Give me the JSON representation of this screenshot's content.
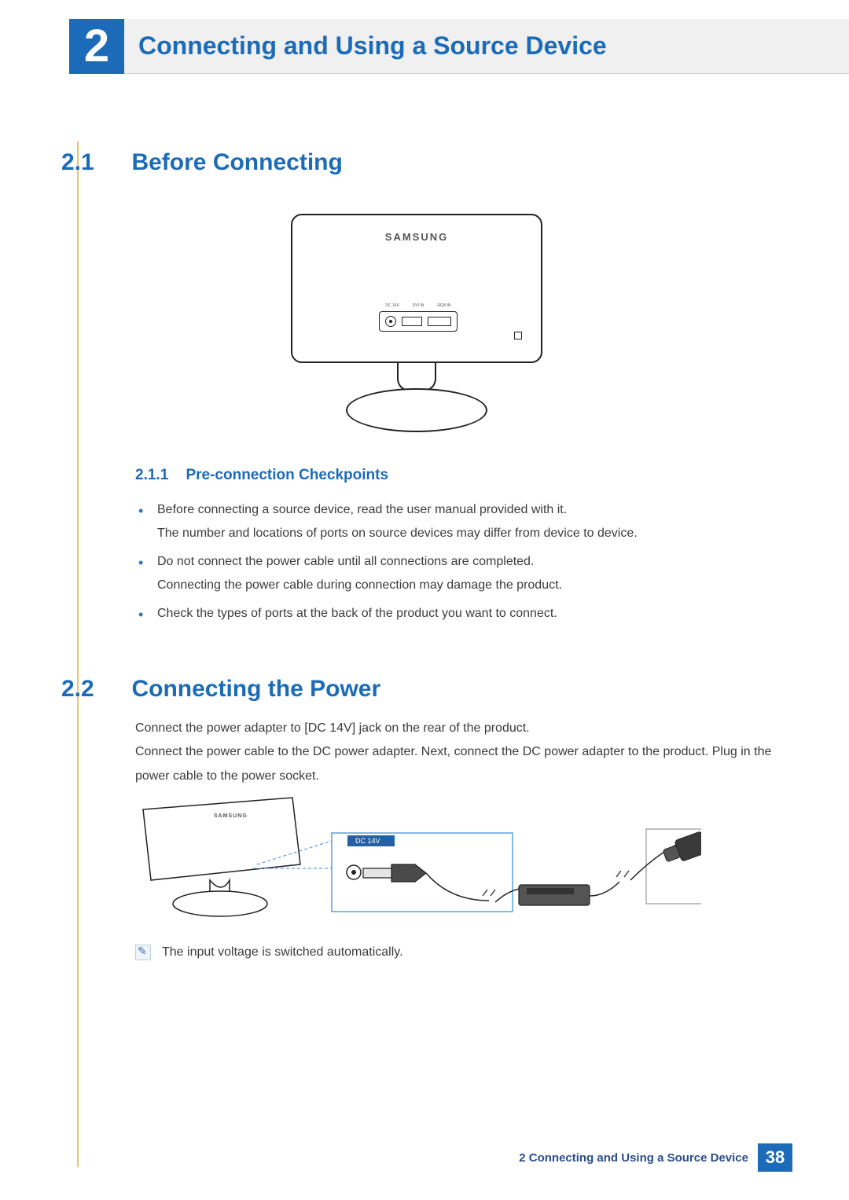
{
  "header": {
    "chapter_number": "2",
    "chapter_title": "Connecting and Using a Source Device"
  },
  "section_2_1": {
    "number": "2.1",
    "title": "Before Connecting"
  },
  "figure_monitor": {
    "brand": "SAMSUNG",
    "port_labels": {
      "a": "DC 14V",
      "b": "DVI IN",
      "c": "RGB IN"
    }
  },
  "subsection_2_1_1": {
    "number": "2.1.1",
    "title": "Pre-connection Checkpoints",
    "bullets": [
      {
        "line1": "Before connecting a source device, read the user manual provided with it.",
        "line2": "The number and locations of ports on source devices may differ from device to device."
      },
      {
        "line1": "Do not connect the power cable until all connections are completed.",
        "line2": "Connecting the power cable during connection may damage the product."
      },
      {
        "line1": "Check the types of ports at the back of the product you want to connect."
      }
    ]
  },
  "section_2_2": {
    "number": "2.2",
    "title": "Connecting the Power",
    "body": "Connect the power adapter to [DC 14V] jack on the rear of the product.\nConnect the power cable to the DC power adapter. Next, connect the DC power adapter to the product. Plug in the power cable to the power socket."
  },
  "power_figure": {
    "callout_label": "DC 14V",
    "monitor_brand": "SAMSUNG"
  },
  "note": {
    "text": "The input voltage is switched automatically."
  },
  "footer": {
    "text": "2 Connecting and Using a Source Device",
    "page": "38"
  }
}
